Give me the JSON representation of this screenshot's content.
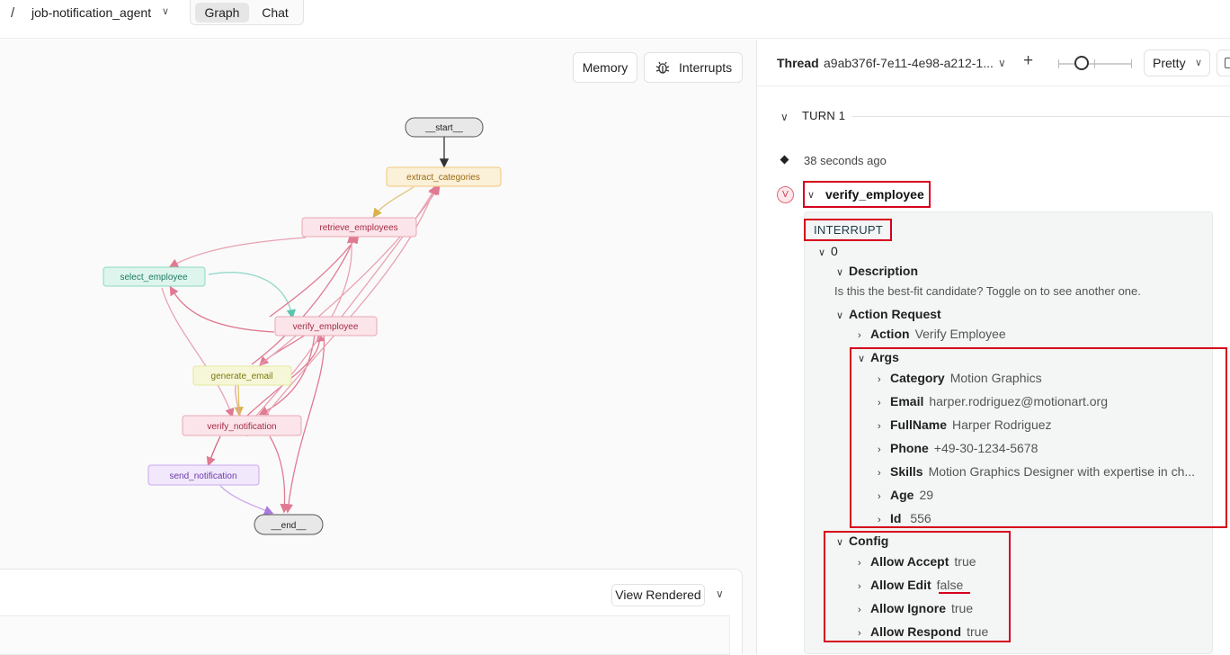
{
  "topbar": {
    "separator": "/",
    "graph_name": "job-notification_agent",
    "tabs": [
      "Graph",
      "Chat"
    ]
  },
  "graph_panel": {
    "memory_label": "Memory",
    "interrupts_label": "Interrupts",
    "view_rendered_label": "View Rendered",
    "nodes": {
      "start": "__start__",
      "extract": "extract_categories",
      "retrieve": "retrieve_employees",
      "select": "select_employee",
      "verify": "verify_employee",
      "generate": "generate_email",
      "verify_notif": "verify_notification",
      "send": "send_notification",
      "end": "__end__"
    }
  },
  "thread": {
    "label": "Thread",
    "id": "a9ab376f-7e11-4e98-a212-1...",
    "view_mode": "Pretty"
  },
  "run": {
    "turn_label": "TURN 1",
    "timestamp": "38 seconds ago",
    "badge": "V",
    "node_title": "verify_employee",
    "interrupt_label": "INTERRUPT",
    "index": "0",
    "description_key": "Description",
    "description_text": "Is this the best-fit candidate? Toggle on to see another one.",
    "action_request_key": "Action Request",
    "action_key": "Action",
    "action_value": "Verify Employee",
    "args_key": "Args",
    "args": [
      {
        "k": "Category",
        "v": "Motion Graphics"
      },
      {
        "k": "Email",
        "v": "harper.rodriguez@motionart.org"
      },
      {
        "k": "FullName",
        "v": "Harper Rodriguez"
      },
      {
        "k": "Phone",
        "v": "+49-30-1234-5678"
      },
      {
        "k": "Skills",
        "v": "Motion Graphics Designer with expertise in ch..."
      },
      {
        "k": "Age",
        "v": "29"
      },
      {
        "k": "Id",
        "v": " 556"
      }
    ],
    "config_key": "Config",
    "config": [
      {
        "k": "Allow Accept",
        "v": "true"
      },
      {
        "k": "Allow Edit",
        "v": "false"
      },
      {
        "k": "Allow Ignore",
        "v": "true"
      },
      {
        "k": "Allow Respond",
        "v": "true"
      }
    ]
  },
  "colors": {
    "annotation_red": "#d6001c",
    "node_yellow": "#f2c87a",
    "node_red": "#e9a7b3",
    "node_green": "#8ad9c0",
    "node_lime": "#e3e89a",
    "node_purple": "#c9a7ef"
  }
}
